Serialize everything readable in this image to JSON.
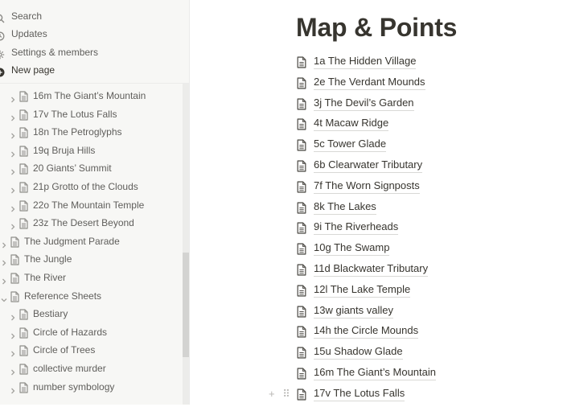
{
  "sidebar": {
    "top_items": [
      {
        "label": "Search",
        "icon": "search-icon"
      },
      {
        "label": "Updates",
        "icon": "clock-icon"
      },
      {
        "label": "Settings & members",
        "icon": "gear-icon"
      },
      {
        "label": "New page",
        "icon": "plus-circle-icon"
      }
    ],
    "tree": [
      {
        "label": "16m The Giant’s Mountain",
        "level": 1
      },
      {
        "label": "17v The Lotus Falls",
        "level": 1
      },
      {
        "label": "18n The Petroglyphs",
        "level": 1
      },
      {
        "label": "19q Bruja Hills",
        "level": 1
      },
      {
        "label": "20 Giants’ Summit",
        "level": 1
      },
      {
        "label": "21p Grotto of the Clouds",
        "level": 1
      },
      {
        "label": "22o The Mountain Temple",
        "level": 1
      },
      {
        "label": "23z The Desert Beyond",
        "level": 1
      },
      {
        "label": "The Judgment Parade",
        "level": 0
      },
      {
        "label": "The Jungle",
        "level": 0
      },
      {
        "label": "The River",
        "level": 0
      },
      {
        "label": "Reference Sheets",
        "level": 0,
        "expanded": true
      },
      {
        "label": "Bestiary",
        "level": 1
      },
      {
        "label": "Circle of Hazards",
        "level": 1
      },
      {
        "label": "Circle of Trees",
        "level": 1
      },
      {
        "label": "collective murder",
        "level": 1
      },
      {
        "label": "number symbology",
        "level": 1
      }
    ]
  },
  "page": {
    "title": "Map & Points",
    "links": [
      "1a The Hidden Village",
      "2e The Verdant Mounds",
      "3j The Devil’s Garden",
      "4t Macaw Ridge",
      "5c Tower Glade",
      "6b Clearwater Tributary",
      "7f The Worn Signposts",
      "8k The Lakes",
      "9i The Riverheads",
      "10g The Swamp",
      "11d Blackwater Tributary",
      "12l The Lake Temple",
      "13w giants valley",
      "14h the Circle Mounds",
      "15u Shadow Glade",
      "16m The Giant’s Mountain",
      "17v The Lotus Falls"
    ],
    "block_handle": {
      "add": "+",
      "drag": "⠿"
    }
  }
}
